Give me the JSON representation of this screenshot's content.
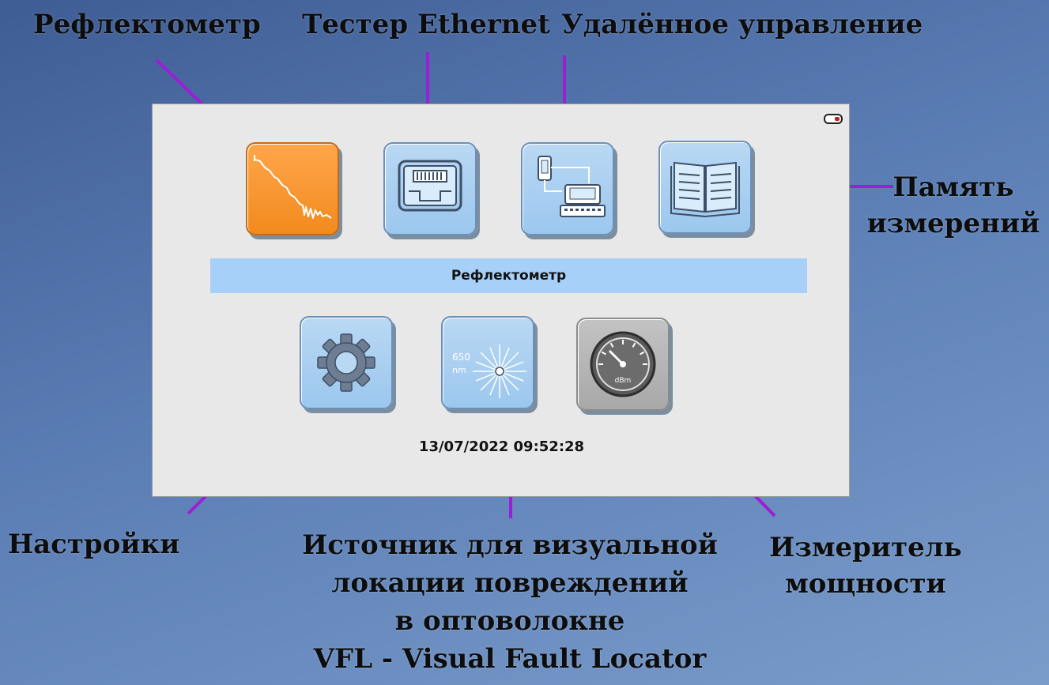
{
  "callouts": {
    "reflectometer": "Рефлектометр",
    "ethernet_tester": "Тестер Ethernet",
    "remote_control": "Удалённое управление",
    "memory_line1": "Память",
    "memory_line2": "измерений",
    "settings": "Настройки",
    "vfl_line1": "Источник для визуальной",
    "vfl_line2": "локации повреждений",
    "vfl_line3": "в оптоволокне",
    "vfl_line4": "VFL - Visual Fault Locator",
    "power_meter_line1": "Измеритель",
    "power_meter_line2": "мощности"
  },
  "screen": {
    "selected_label": "Рефлектометр",
    "datetime": "13/07/2022 09:52:28",
    "vfl_icon_text_line1": "650",
    "vfl_icon_text_line2": "nm",
    "power_icon_text": "dBm"
  },
  "colors": {
    "leader_line": "#9b1fd6",
    "tile_active": "#f28a1e",
    "tile_normal": "#a6cdf2",
    "tile_disabled": "#b0b0b0",
    "banner": "#a6d0f7",
    "battery_level": "#d21a1a"
  },
  "icons": {
    "reflectometer": "trace-icon",
    "ethernet_tester": "ethernet-port-icon",
    "remote_control": "remote-device-icon",
    "memory": "open-book-icon",
    "settings": "gear-icon",
    "vfl": "laser-burst-icon",
    "power_meter": "gauge-icon",
    "battery": "battery-icon"
  }
}
